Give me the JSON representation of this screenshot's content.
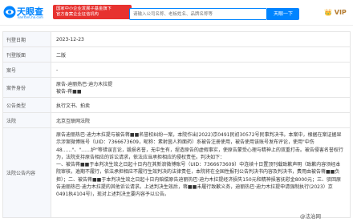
{
  "header": {
    "logo_text": "天眼查",
    "logo_sub": "TianYanCha.com",
    "gov_badge_line1": "国家中小企业发展子基金旗下",
    "gov_badge_line2": "官方备案企业征信机构",
    "search_placeholder": "请输入公司名称、老板姓名、品牌名称等",
    "search_button": "天眼一下",
    "vip": "👑 VIP"
  },
  "rows": [
    {
      "key": "刊登日期",
      "value": "2023-12-23"
    },
    {
      "key": "刊登版面",
      "value": "二版"
    },
    {
      "key": "案号",
      "value": "-"
    },
    {
      "key": "案件身份",
      "value_line1": "原告-迪丽热巴·迪力木拉提",
      "value_line2": "被告-蒋■■"
    },
    {
      "key": "公告类型",
      "value": "执行文书、拍卖"
    },
    {
      "key": "法院",
      "value": "北京互联网法院"
    },
    {
      "key": "法院公告内容",
      "paragraphs": [
        "原告迪丽热巴·迪力木拉提与被告蒋■■名誉权纠纷一案，本院作出(2022)京0491民初30572号民事判决书。本案中，根据在案证据显示涉案微博账号（UID：7366673609，昵称：素射茵人狗面药）系被告注册使用，被告使用该账号发布评论，使用\"中伤48……\"、\"……护\"等错误言论，毁损名誉，无中生有，捏造原告的虚假事实，使原告蒙受心理与精神上的双重打击。被告侵害名誉权行为，法院支持原告相应的诉讼请求，依法应当承担相应的侵权责任。判决如下：",
        "一、被告蒋■■于本判决生效之日起十日内在其新浪微博账号（UID：7366673609）中连续十日置顶刊载致歉声明（致歉内容须经本院审核，逾期不履行，依法承担相应不履行生效判决的法律责任，本院将在全国性报刊公告判决书内容及判决书，费用由被告蒋■■负担）；二、被告蒋■■于本判决生效之日起十日内赔偿原告迪丽热巴·迪力木拉提经济损失150元和精神损害抚慰金8000元；三、驳回原告迪丽热巴·迪力木拉提的其他诉讼请求。上述判决生效后，蒋■■未履行致歉义务，迪丽热巴·迪力木拉提申请强制执行(2023）京0491执4104号)，现对上述判决主要内容予以公告。"
      ]
    }
  ],
  "watermark": "@法治网"
}
